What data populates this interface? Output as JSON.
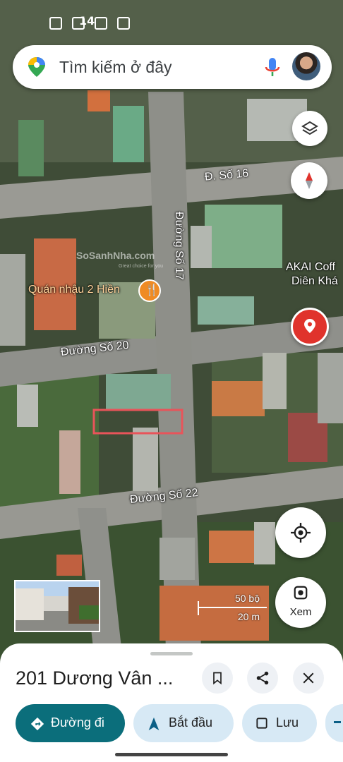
{
  "status_bar": {
    "time": "14"
  },
  "search": {
    "placeholder": "Tìm kiếm ở đây"
  },
  "map": {
    "labels": {
      "road_16": "Đ. Số 16",
      "road_17": "Đường Số 17",
      "road_20": "Đường Số 20",
      "road_22": "Đường Số 22",
      "poi_quan_nhau": "Quán nhậu 2 Hiền",
      "poi_akai_1": "AKAI Coff",
      "poi_akai_2": "Diên Khá",
      "watermark_brand": "SoSanhNha.com",
      "watermark_tagline": "Great choice for you"
    },
    "scale": {
      "feet": "50 bộ",
      "meters": "20 m"
    },
    "explore_label": "Xem"
  },
  "sheet": {
    "place_name": "201 Dương Vân ...",
    "buttons": {
      "directions": "Đường đi",
      "start": "Bắt đầu",
      "save": "Lưu"
    }
  },
  "colors": {
    "accent_teal": "#0b6e7b",
    "pin_red": "#e0332c",
    "poi_orange": "#ef8b24",
    "highlight_box": "#e8545a"
  }
}
